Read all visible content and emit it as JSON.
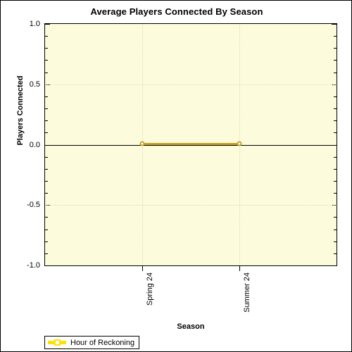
{
  "chart_data": {
    "type": "line",
    "title": "Average Players Connected By Season",
    "xlabel": "Season",
    "ylabel": "Players Connected",
    "categories": [
      "Spring 24",
      "Summer 24"
    ],
    "series": [
      {
        "name": "Hour of Reckoning",
        "values": [
          0,
          0
        ]
      }
    ],
    "ylim": [
      -1.0,
      1.0
    ],
    "ytick_labels": [
      "1.0",
      "0.5",
      "0.0",
      "-0.5",
      "-1.0"
    ],
    "ytick_values": [
      1.0,
      0.5,
      0.0,
      -0.5,
      -1.0
    ],
    "yminor_step": 0.1,
    "grid": true,
    "grid_color": "#e4d9a8",
    "plot_background": "#fcfcdd",
    "page_background": "#ffffff",
    "series_color": "#c9a227",
    "legend_swatch_color": "#ffe000",
    "legend_position": "below-left",
    "legend": [
      "Hour of Reckoning"
    ]
  },
  "legend": {
    "entries": [
      {
        "label": "Hour of Reckoning"
      }
    ]
  }
}
